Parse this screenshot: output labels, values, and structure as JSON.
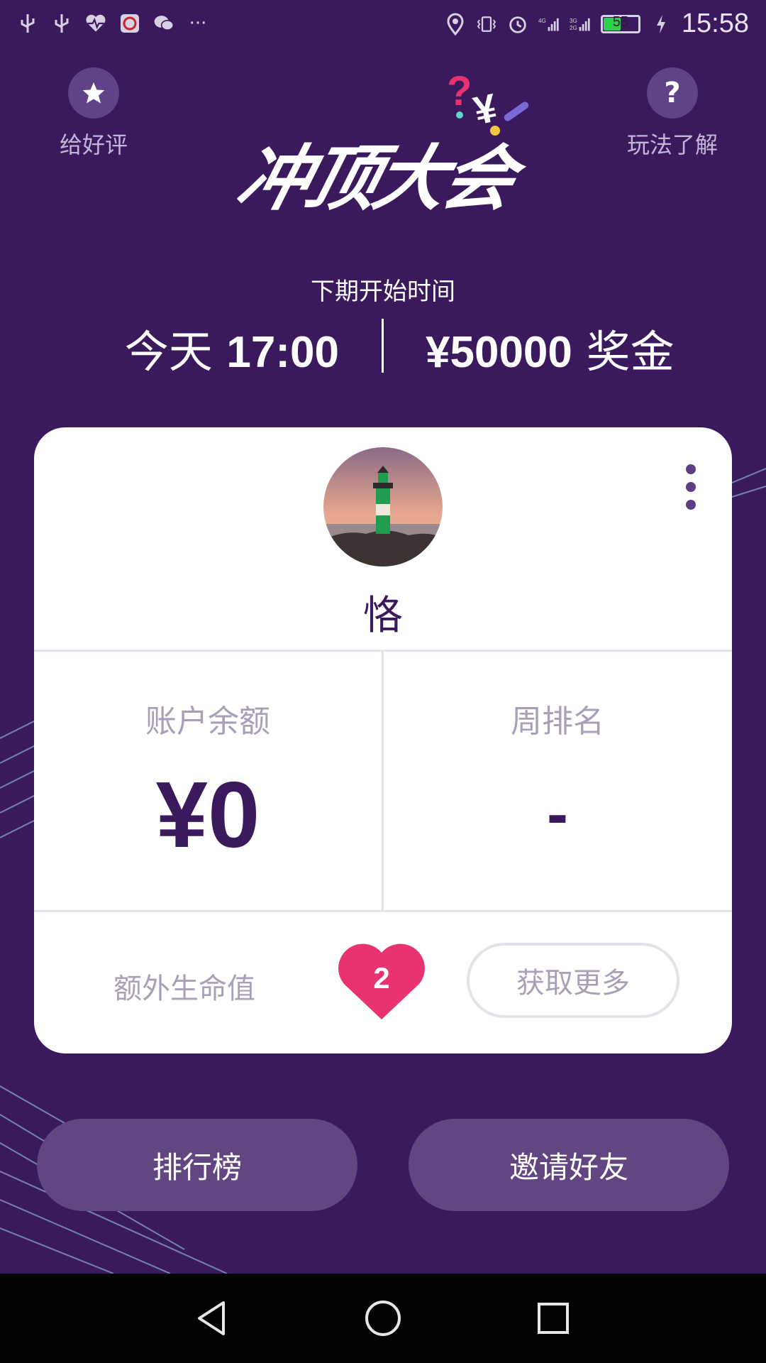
{
  "status_bar": {
    "left_icons": [
      "usb-icon",
      "usb-icon",
      "heartbeat-icon",
      "bank-app-icon",
      "wechat-icon",
      "more-notifications-icon"
    ],
    "right_icons": [
      "location-icon",
      "vibrate-icon",
      "alarm-icon",
      "signal-4g-icon",
      "signal-3g-icon"
    ],
    "battery_level": 55,
    "battery_text": "55",
    "time": "15:58"
  },
  "header": {
    "rate_label": "给好评",
    "rate_icon": "star-icon",
    "howto_label": "玩法了解",
    "howto_icon": "question-icon",
    "logo_text": "冲顶大会"
  },
  "next_round": {
    "label": "下期开始时间",
    "day": "今天",
    "time": "17:00",
    "prize_amount": "¥50000",
    "prize_suffix": "奖金"
  },
  "profile": {
    "avatar": "lighthouse-avatar",
    "username": "恪",
    "balance_label": "账户余额",
    "balance_value": "¥0",
    "rank_label": "周排名",
    "rank_value": "-",
    "extra_lives_label": "额外生命值",
    "extra_lives_count": "2",
    "get_more_label": "获取更多"
  },
  "actions": {
    "leaderboard_label": "排行榜",
    "invite_label": "邀请好友"
  },
  "colors": {
    "background": "#3a1a5c",
    "accent_purple": "#614682",
    "heart_pink": "#e8336f",
    "card": "#ffffff"
  }
}
